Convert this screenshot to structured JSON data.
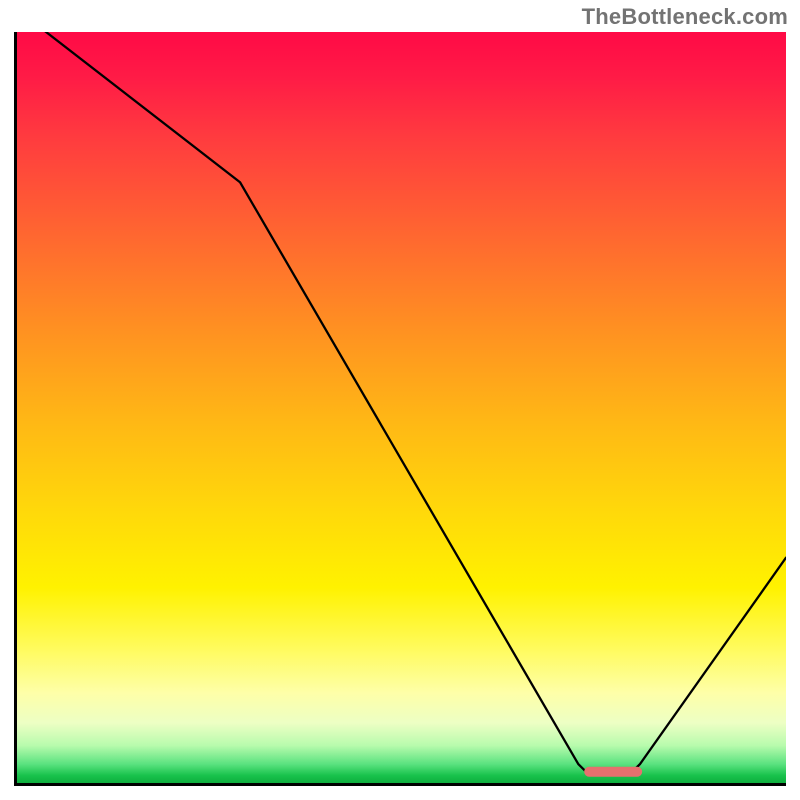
{
  "watermark": "TheBottleneck.com",
  "chart_data": {
    "type": "line",
    "title": "",
    "xlabel": "",
    "ylabel": "",
    "xlim": [
      0,
      100
    ],
    "ylim": [
      0,
      100
    ],
    "gradient_stops": [
      {
        "pct": 0,
        "color": "#ff0a46"
      },
      {
        "pct": 6,
        "color": "#ff1b46"
      },
      {
        "pct": 14,
        "color": "#ff3b3f"
      },
      {
        "pct": 28,
        "color": "#ff6a2f"
      },
      {
        "pct": 40,
        "color": "#ff9221"
      },
      {
        "pct": 52,
        "color": "#ffb815"
      },
      {
        "pct": 64,
        "color": "#ffd90a"
      },
      {
        "pct": 74,
        "color": "#fff200"
      },
      {
        "pct": 82,
        "color": "#fffb5c"
      },
      {
        "pct": 88,
        "color": "#feffa8"
      },
      {
        "pct": 92,
        "color": "#edffc4"
      },
      {
        "pct": 95,
        "color": "#b8fbad"
      },
      {
        "pct": 97.5,
        "color": "#5ae27f"
      },
      {
        "pct": 99,
        "color": "#18c24c"
      },
      {
        "pct": 100,
        "color": "#0fae3e"
      }
    ],
    "series": [
      {
        "name": "bottleneck-curve",
        "points": [
          {
            "x": 0.0,
            "y": 103.0
          },
          {
            "x": 29.0,
            "y": 80.0
          },
          {
            "x": 73.0,
            "y": 2.5
          },
          {
            "x": 74.0,
            "y": 1.5
          },
          {
            "x": 80.0,
            "y": 1.5
          },
          {
            "x": 81.0,
            "y": 2.5
          },
          {
            "x": 100.0,
            "y": 30.0
          }
        ]
      }
    ],
    "marker": {
      "x": 77.5,
      "y": 1.5,
      "width_pct": 7.5,
      "height_pct": 1.4,
      "color": "#e6706e"
    }
  }
}
